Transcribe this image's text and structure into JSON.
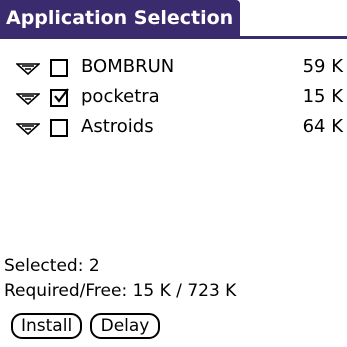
{
  "window": {
    "title": "Application Selection"
  },
  "apps": [
    {
      "name": "BOMBRUN",
      "size": "59 K",
      "checked": false
    },
    {
      "name": "pocketra",
      "size": "15 K",
      "checked": true
    },
    {
      "name": "Astroids",
      "size": "64 K",
      "checked": false
    }
  ],
  "status": {
    "selected": "Selected: 2",
    "required_free": "Required/Free: 15 K / 723 K"
  },
  "buttons": {
    "install": "Install",
    "delay": "Delay"
  },
  "icons": {
    "expand": "expand-triangle-icon",
    "checkbox": "checkbox-icon"
  },
  "colors": {
    "title_bg": "#3a2a6e",
    "title_text": "#ffffff"
  }
}
